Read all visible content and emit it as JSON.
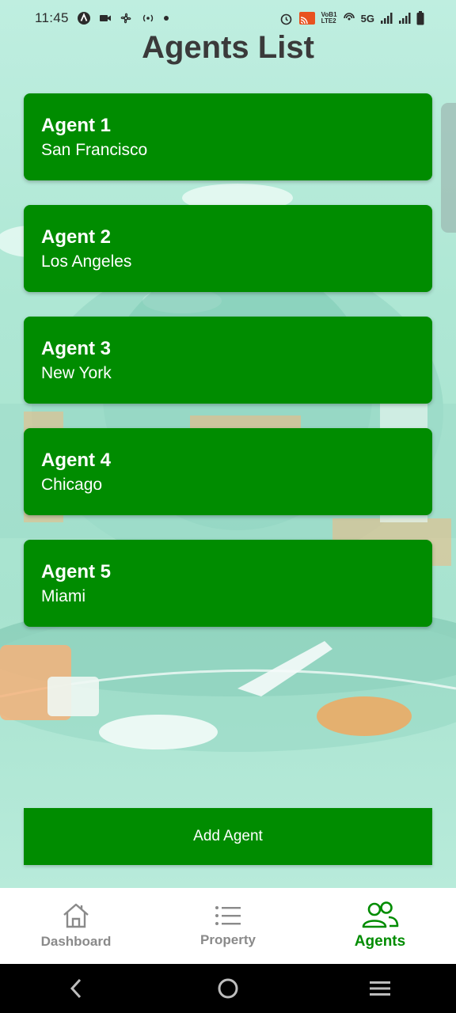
{
  "status_bar": {
    "time": "11:45",
    "network": "5G",
    "volte": "VoB1 LTE2"
  },
  "page": {
    "title": "Agents List"
  },
  "agents": [
    {
      "name": "Agent 1",
      "city": "San Francisco"
    },
    {
      "name": "Agent 2",
      "city": "Los Angeles"
    },
    {
      "name": "Agent 3",
      "city": "New York"
    },
    {
      "name": "Agent 4",
      "city": "Chicago"
    },
    {
      "name": "Agent 5",
      "city": "Miami"
    }
  ],
  "actions": {
    "add_agent_label": "Add Agent"
  },
  "bottom_nav": {
    "items": [
      {
        "label": "Dashboard",
        "icon": "home-icon",
        "active": false
      },
      {
        "label": "Property",
        "icon": "list-icon",
        "active": false
      },
      {
        "label": "Agents",
        "icon": "people-icon",
        "active": true
      }
    ]
  },
  "colors": {
    "primary": "#008c00",
    "title": "#3a3a3a",
    "nav_inactive": "#8a8a8a"
  }
}
